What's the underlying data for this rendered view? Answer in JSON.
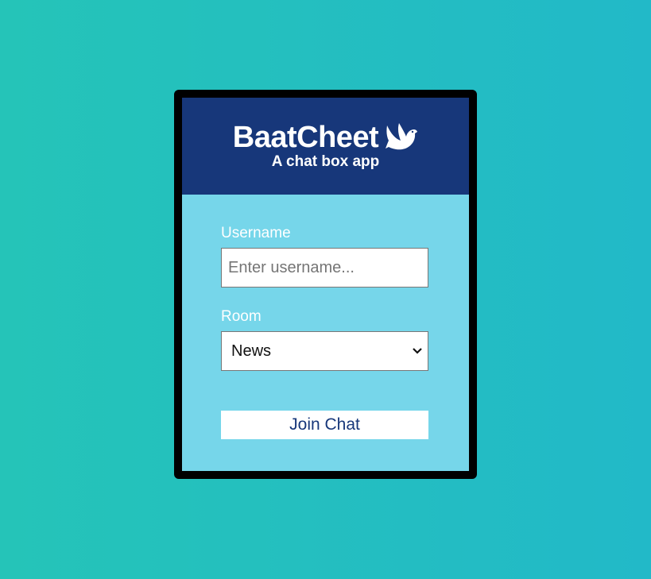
{
  "header": {
    "title": "BaatCheet",
    "subtitle": "A chat box app",
    "icon": "dove-icon"
  },
  "form": {
    "username": {
      "label": "Username",
      "placeholder": "Enter username...",
      "value": ""
    },
    "room": {
      "label": "Room",
      "selected": "News"
    },
    "submit_label": "Join Chat"
  },
  "colors": {
    "background_start": "#25c4b8",
    "background_end": "#22b9c8",
    "header": "#17377a",
    "card": "#76d6ea",
    "border": "#000000"
  }
}
